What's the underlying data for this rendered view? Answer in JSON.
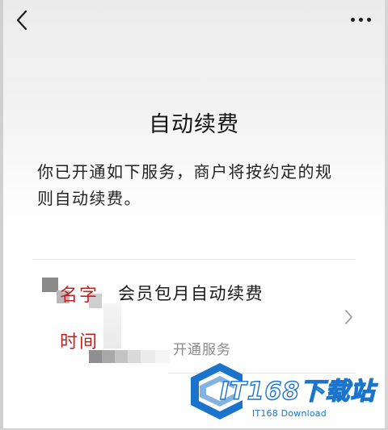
{
  "header": {
    "back_icon": "chevron-left-icon",
    "more_icon": "more-dots-icon"
  },
  "main": {
    "title": "自动续费",
    "description_line1": "你已开通如下服务，商户将按约定的规",
    "description_line2": "则自动续费。"
  },
  "service": {
    "annotation_name": "名字",
    "annotation_time": "时间",
    "name": "会员包月自动续费",
    "status": "开通服务",
    "chevron_icon": "chevron-right-icon"
  },
  "watermark": {
    "brand": "IT168下载站",
    "sub": "IT168 Download",
    "color": "#1a74cc"
  },
  "colors": {
    "annotation": "#c81e1e",
    "text_primary": "#141414",
    "text_secondary": "#8a8a8a"
  }
}
